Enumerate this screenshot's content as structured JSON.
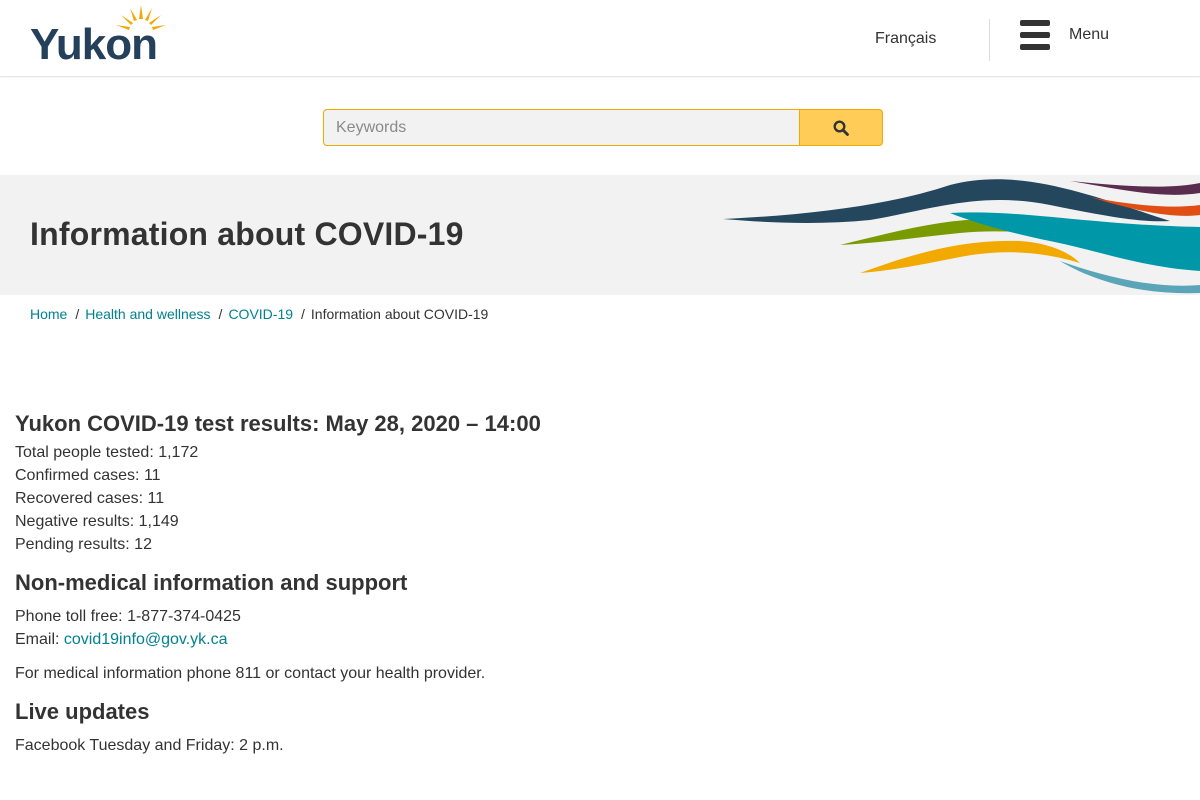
{
  "header": {
    "logo_text": "Yukon",
    "language_link": "Français",
    "menu_label": "Menu"
  },
  "search": {
    "placeholder": "Keywords",
    "button_icon": "search-icon"
  },
  "hero": {
    "title": "Information about COVID-19"
  },
  "breadcrumb": {
    "items": [
      {
        "label": "Home"
      },
      {
        "label": "Health and wellness"
      },
      {
        "label": "COVID-19"
      }
    ],
    "current": "Information about COVID-19",
    "separator": "/"
  },
  "test_results": {
    "heading": "Yukon COVID-19 test results: May 28, 2020 – 14:00",
    "lines": [
      "Total people tested: 1,172",
      "Confirmed cases: 11",
      "Recovered cases: 11",
      "Negative results: 1,149",
      "Pending results: 12"
    ]
  },
  "support": {
    "heading": "Non-medical information and support",
    "phone": "Phone toll free: 1-877-374-0425",
    "email_label": "Email: ",
    "email_link": "covid19info@gov.yk.ca",
    "medical_note": "For medical information phone 811 or contact your health provider."
  },
  "live_updates": {
    "heading": "Live updates",
    "facebook": "Facebook Tuesday and Friday: 2 p.m."
  },
  "colors": {
    "link": "#00818f",
    "search_button": "#ffcd57",
    "search_border": "#f2a900",
    "hero_background": "#f2f2f2",
    "text": "#333333"
  }
}
